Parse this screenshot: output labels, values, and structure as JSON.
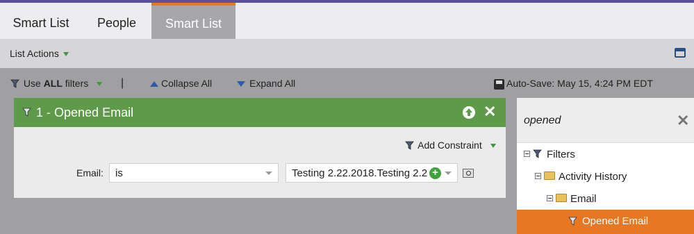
{
  "tabs": [
    {
      "label": "Smart List"
    },
    {
      "label": "People"
    },
    {
      "label": "Smart List"
    }
  ],
  "actions_bar": {
    "list_actions_label": "List Actions"
  },
  "filter_bar": {
    "use_label_prefix": "Use ",
    "use_label_bold": "ALL",
    "use_label_suffix": " filters",
    "separator": "|",
    "collapse_all": "Collapse All",
    "expand_all": "Expand All",
    "auto_save": "Auto-Save: May 15, 4:24 PM EDT"
  },
  "filter_card": {
    "title": "1 - Opened Email",
    "add_constraint": "Add Constraint",
    "field_label": "Email:",
    "operator": "is",
    "value": "Testing 2.22.2018.Testing 2.22"
  },
  "side_panel": {
    "search_value": "opened",
    "tree": [
      {
        "label": "Filters"
      },
      {
        "label": "Activity History"
      },
      {
        "label": "Email"
      },
      {
        "label": "Opened Email"
      }
    ]
  },
  "colors": {
    "accent_orange": "#e87722",
    "filter_green": "#5f9a4a",
    "top_purple": "#5b4fa0"
  }
}
